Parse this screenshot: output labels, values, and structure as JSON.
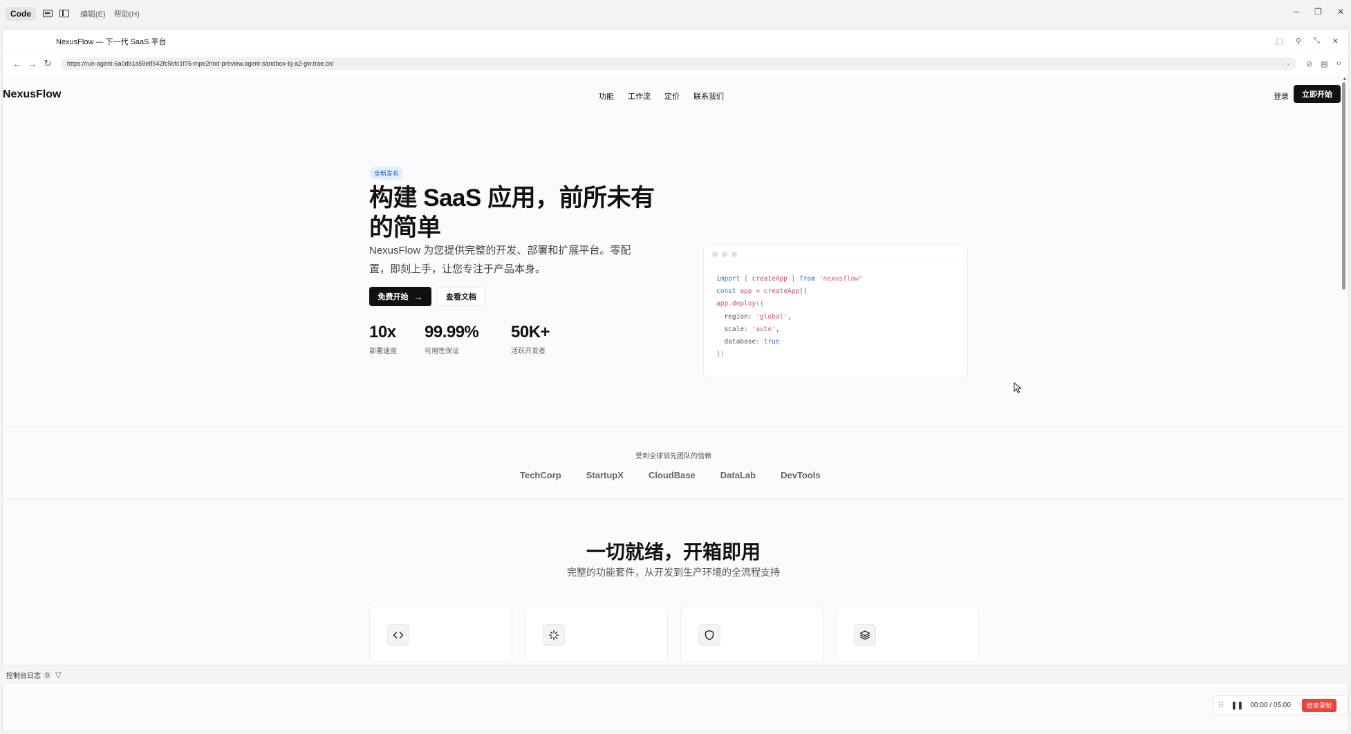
{
  "app": {
    "code_label": "Code",
    "menu_edit": "编辑(E)",
    "menu_help": "帮助(H)",
    "win_minimize": "─",
    "win_restore": "❐",
    "win_close": "✕"
  },
  "browser": {
    "tab_title": "NexusFlow — 下一代 SaaS 平台",
    "url": "https://run-agent-6a0db1a59e8542fc5bfc1f75-mpe2rlod-preview.agent-sandbox-bj-a2-gw.trae.cn/",
    "nav_back": "←",
    "nav_forward": "→",
    "nav_reload": "↻",
    "url_chevron": "⌄",
    "ic_cursor": "⬚",
    "ic_pin": "⚲",
    "ic_shrink": "⤡",
    "ic_close": "✕",
    "ic_extension": "⊘",
    "ic_reader": "▤",
    "ic_devtools": "‹›"
  },
  "site": {
    "logo": "NexusFlow",
    "nav": [
      "功能",
      "工作流",
      "定价",
      "联系我们"
    ],
    "login": "登录",
    "cta": "立即开始",
    "hero": {
      "badge": "全新发布",
      "title": "构建 SaaS 应用，前所未有的简单",
      "desc": "NexusFlow 为您提供完整的开发、部署和扩展平台。零配置，即刻上手，让您专注于产品本身。",
      "primary_button": "免费开始",
      "primary_arrow": "→",
      "secondary_button": "查看文档"
    },
    "stats": [
      {
        "value": "10x",
        "label": "部署速度"
      },
      {
        "value": "99.99%",
        "label": "可用性保证"
      },
      {
        "value": "50K+",
        "label": "活跃开发者"
      }
    ],
    "code": {
      "l1_import": "import",
      "l1_brace_open": " { ",
      "l1_fn": "createApp",
      "l1_brace_close": " } ",
      "l1_from": "from",
      "l1_str": " 'nexusflow'",
      "l2_const": "const",
      "l2_app": " app = ",
      "l2_fn": "createApp",
      "l2_paren": "()",
      "l3_call": "app.deploy",
      "l3_open": "({",
      "l4_key": "  region: ",
      "l4_val": "'global'",
      "l4_comma": ",",
      "l5_key": "  scale: ",
      "l5_val": "'auto'",
      "l5_comma": ",",
      "l6_key": "  database: ",
      "l6_val": "true",
      "l7_close": "})"
    },
    "trust": {
      "label": "受到全球领先团队的信赖",
      "brands": [
        "TechCorp",
        "StartupX",
        "CloudBase",
        "DataLab",
        "DevTools"
      ]
    },
    "features": {
      "title": "一切就绪，开箱即用",
      "subtitle": "完整的功能套件，从开发到生产环境的全流程支持",
      "icons": [
        "code-icon",
        "sparkle-icon",
        "shield-icon",
        "layers-icon"
      ]
    }
  },
  "console": {
    "label": "控制台日志",
    "count": "0",
    "filter_icon": "▽"
  },
  "recorder": {
    "grip": "⠿",
    "pause": "❚❚",
    "time": "00:00 / 05:00",
    "stop": "结束录制"
  }
}
